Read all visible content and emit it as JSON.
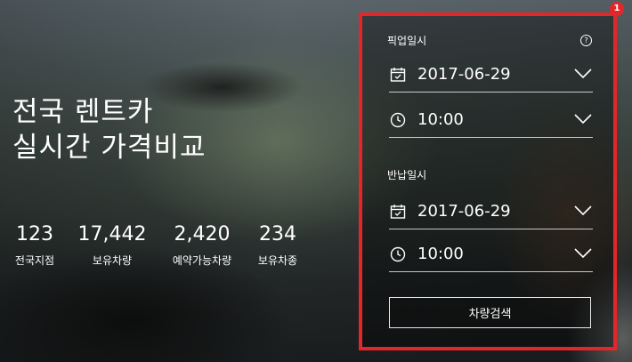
{
  "hero": {
    "headline_line1": "전국 렌트카",
    "headline_line2": "실시간 가격비교"
  },
  "stats": [
    {
      "value": "123",
      "label": "전국지점"
    },
    {
      "value": "17,442",
      "label": "보유차량"
    },
    {
      "value": "2,420",
      "label": "예약가능차량"
    },
    {
      "value": "234",
      "label": "보유차종"
    }
  ],
  "annotation": {
    "marker": "1",
    "color": "#e3262a"
  },
  "pickup": {
    "label": "픽업일시",
    "help_icon": "question-circle-icon",
    "date": "2017-06-29",
    "time": "10:00"
  },
  "return": {
    "label": "반납일시",
    "date": "2017-06-29",
    "time": "10:00"
  },
  "search_button": {
    "label": "차량검색"
  },
  "icons": {
    "date": "calendar-icon",
    "time": "clock-icon",
    "dropdown": "chevron-down-icon"
  }
}
